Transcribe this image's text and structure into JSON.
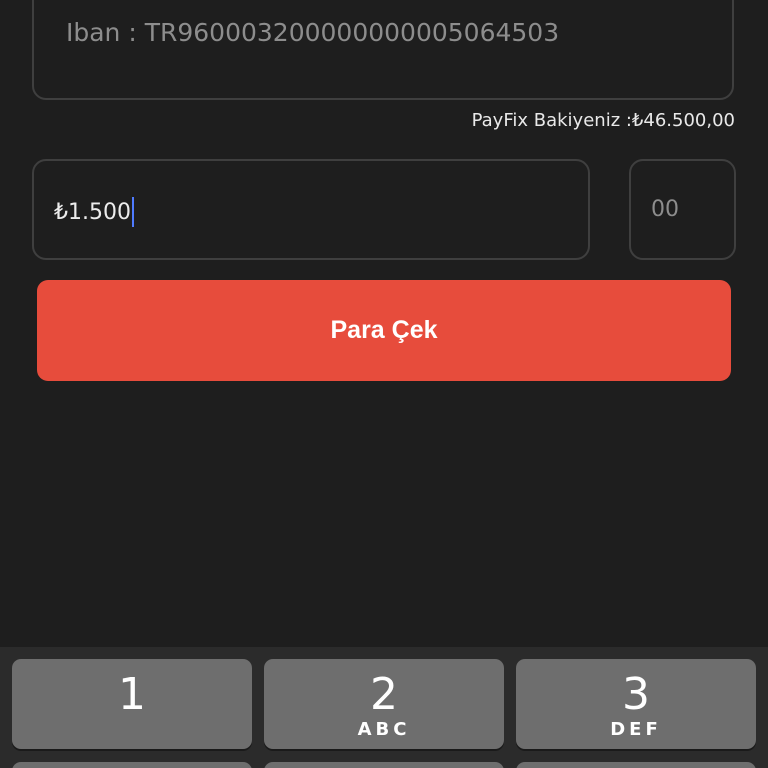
{
  "iban_field": {
    "text": "Iban : TR960003200000000005064503"
  },
  "balance": {
    "text": "PayFix Bakiyeniz :₺46.500,00"
  },
  "amount_field": {
    "value": "₺1.500"
  },
  "cents_field": {
    "value": "00"
  },
  "withdraw_button": {
    "label": "Para Çek"
  },
  "colors": {
    "background": "#1e1e1e",
    "accent": "#e74c3c",
    "caret": "#4f7bff",
    "key": "#6e6e6e"
  },
  "keyboard": {
    "keys": [
      {
        "num": "1",
        "letters": ""
      },
      {
        "num": "2",
        "letters": "ABC"
      },
      {
        "num": "3",
        "letters": "DEF"
      }
    ]
  }
}
